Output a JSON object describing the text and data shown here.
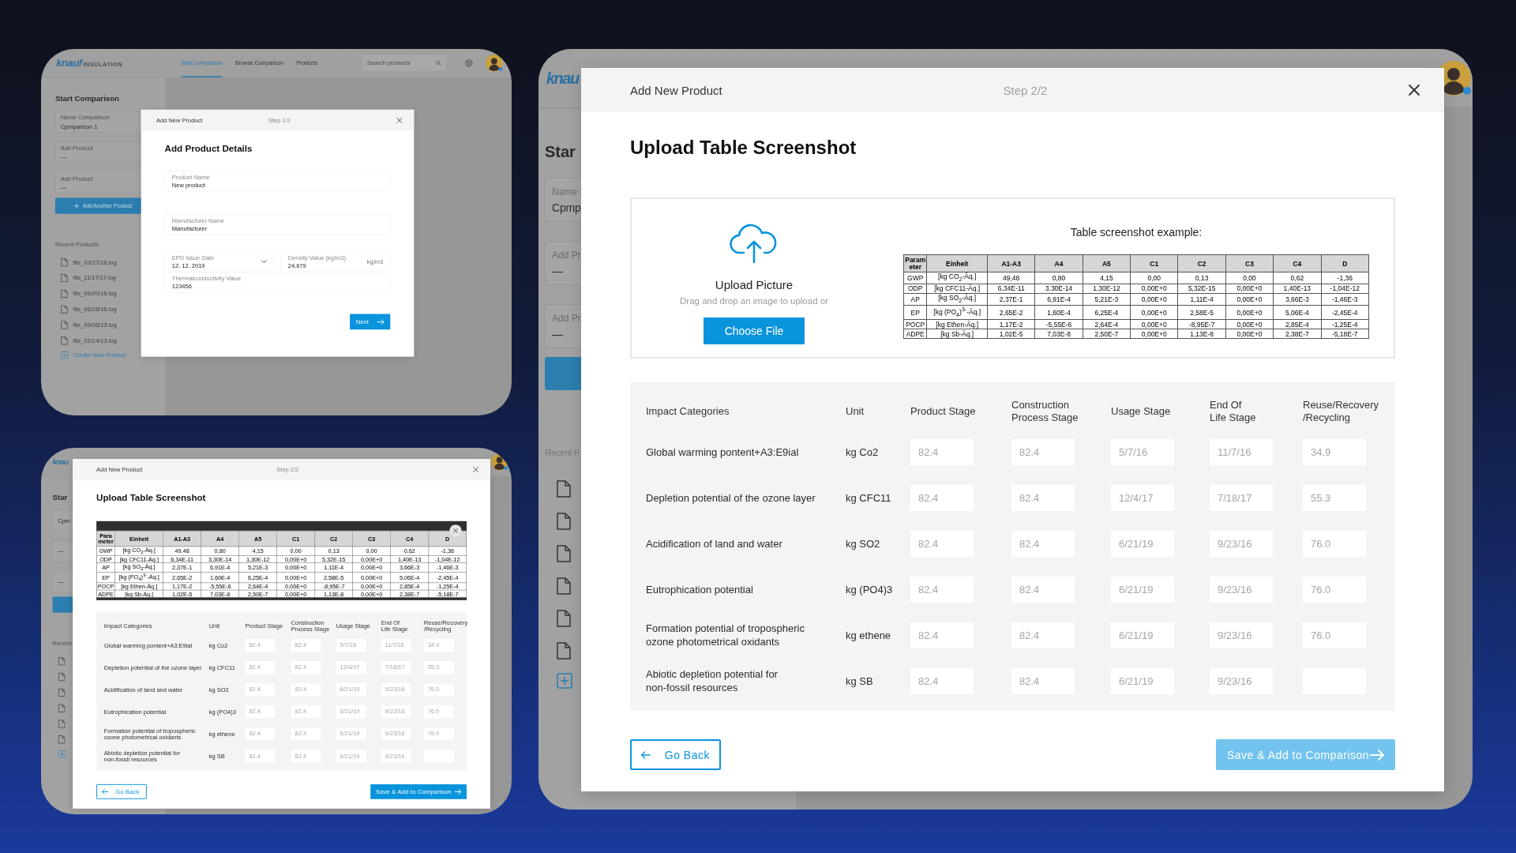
{
  "panels": [
    {
      "kind": "details",
      "app": {
        "logo": {
          "brand": "knauf",
          "sub": "INSULATION"
        },
        "nav": [
          {
            "label": "Start Comparison",
            "selected": true
          },
          {
            "label": "Browse Comparison",
            "selected": false
          },
          {
            "label": "Products",
            "selected": false
          }
        ],
        "search": {
          "placeholder": "Search products"
        },
        "sidebar": {
          "title": "Start Comparison",
          "fields": [
            {
              "label": "Name Comparison",
              "value": "Cpmparison 1"
            },
            {
              "label": "Add Product",
              "value": "—"
            },
            {
              "label": "Add Product",
              "value": "—"
            }
          ],
          "add_button": {
            "kind": "labeled",
            "label": "Add Another Product"
          },
          "recent_title": "Recent Products",
          "files": [
            {
              "kind": "named",
              "name": "file_03/27/18.log"
            },
            {
              "kind": "named",
              "name": "file_11/17/17.log"
            },
            {
              "kind": "named",
              "name": "file_06/20/16.log"
            },
            {
              "kind": "named",
              "name": "file_06/28/16.log"
            },
            {
              "kind": "named",
              "name": "file_09/06/13.log"
            },
            {
              "kind": "named",
              "name": "file_02/14/13.log"
            }
          ],
          "create": {
            "kind": "link",
            "label": "Create New Product"
          }
        }
      },
      "modal": {
        "title": "Add New Product",
        "step": "Step 1/2",
        "heading": "Add Product Details",
        "field_rows": [
          [
            {
              "kind": "text",
              "label": "Product Name",
              "value": "New product"
            }
          ],
          [
            {
              "kind": "text",
              "label": "Manufacturer Name",
              "value": "Manufacturer"
            }
          ],
          [
            {
              "kind": "select",
              "label": "EPD Issue Date",
              "value": "12. 12. 2019"
            },
            {
              "kind": "unit",
              "label": "Density Value (kg/m3)",
              "value": "24,679",
              "unit": "kg/m3"
            }
          ],
          [
            {
              "kind": "text",
              "label": "Thermalconductivity Value",
              "value": "123456"
            }
          ]
        ],
        "buttons": [
          {
            "kind": "next",
            "label": "Next"
          }
        ]
      }
    },
    {
      "kind": "preview",
      "app": {
        "logo": {
          "brand": "knau"
        },
        "sidebar": {
          "title": "Star",
          "fields": [
            {
              "value": "Cpm"
            },
            {
              "value": "—"
            },
            {
              "value": "—"
            }
          ],
          "add_button": {
            "kind": "blank"
          },
          "recent_title": "Recent",
          "files": [
            {
              "kind": "icon"
            },
            {
              "kind": "icon"
            },
            {
              "kind": "icon"
            },
            {
              "kind": "icon"
            },
            {
              "kind": "icon"
            },
            {
              "kind": "icon"
            }
          ],
          "create": {
            "kind": "icon"
          }
        }
      },
      "modal": {
        "title": "Add New Product",
        "step": "Step 2/2",
        "heading": "Upload Table Screenshot",
        "upload": {
          "kind": "preview",
          "example_table": {
            "columns": [
              "Parameter",
              "Einheit",
              "A1-A3",
              "A4",
              "A5",
              "C1",
              "C2",
              "C3",
              "C4",
              "D"
            ],
            "rows": [
              [
                "GWP",
                "[kg CO$_{2}$-Äq.]",
                "49,48",
                "0,80",
                "4,15",
                "0,00",
                "0,13",
                "0,00",
                "0,62",
                "-1,36"
              ],
              [
                "ODP",
                "[kg CFC11-Äq.]",
                "6,34E-11",
                "3,30E-14",
                "1,30E-12",
                "0,00E+0",
                "5,32E-15",
                "0,00E+0",
                "1,40E-13",
                "-1,04E-12"
              ],
              [
                "AP",
                "[kg SO$_{2}$-Äq.]",
                "2,37E-1",
                "6,91E-4",
                "5,21E-3",
                "0,00E+0",
                "1,11E-4",
                "0,00E+0",
                "3,66E-3",
                "-1,46E-3"
              ],
              [
                "EP",
                "[kg (PO$_{4}$)$^{3-}$-Äq.]",
                "2,65E-2",
                "1,60E-4",
                "6,25E-4",
                "0,00E+0",
                "2,58E-5",
                "0,00E+0",
                "5,06E-4",
                "-2,45E-4"
              ],
              [
                "POCP",
                "[kg Ethen-Äq.]",
                "1,17E-2",
                "-5,55E-6",
                "2,64E-4",
                "0,00E+0",
                "-8,95E-7",
                "0,00E+0",
                "2,85E-4",
                "-1,25E-4"
              ],
              [
                "ADPE",
                "[kg Sb-Äq.]",
                "1,02E-5",
                "7,03E-8",
                "2,50E-7",
                "0,00E+0",
                "1,13E-8",
                "0,00E+0",
                "2,38E-7",
                "-5,18E-7"
              ]
            ]
          }
        },
        "impact_table": {
          "columns": [
            "Impact Categories",
            "Unit",
            "Product Stage",
            "Construction\nProcess Stage",
            "Usage Stage",
            "End Of\nLife Stage",
            "Reuse/Recovery\n/Recycling"
          ],
          "rows": [
            {
              "category": "Global warming pontent+A3:E9ial",
              "unit": "kg Co2",
              "values": [
                "82.4",
                "82.4",
                "5/7/16",
                "11/7/16",
                "34.9"
              ]
            },
            {
              "category": "Depletion potential of the ozone layer",
              "unit": "kg CFC11",
              "values": [
                "82.4",
                "82.4",
                "12/4/17",
                "7/18/17",
                "55.3"
              ]
            },
            {
              "category": "Acidification of land and water",
              "unit": "kg SO2",
              "values": [
                "82.4",
                "82.4",
                "6/21/19",
                "9/23/16",
                "76.0"
              ]
            },
            {
              "category": "Eutrophication potential",
              "unit": "kg (PO4)3",
              "values": [
                "82.4",
                "82.4",
                "6/21/19",
                "9/23/16",
                "76.0"
              ]
            },
            {
              "category": "Formation potential of tropospheric\nozone photometrical oxidants",
              "unit": "kg ethene",
              "values": [
                "82.4",
                "82.4",
                "6/21/19",
                "9/23/16",
                "76.0"
              ]
            },
            {
              "category": "Abiotic depletion potential for\nnon-fossil resources",
              "unit": "kg SB",
              "values": [
                "82.4",
                "82.4",
                "6/21/19",
                "9/23/16"
              ]
            }
          ]
        },
        "buttons": [
          {
            "kind": "back",
            "label": "Go Back"
          },
          {
            "kind": "save",
            "label": "Save & Add to Comparison",
            "disabled": false
          }
        ]
      }
    },
    {
      "kind": "dropzone",
      "app": {
        "logo": {
          "brand": "knau"
        },
        "sidebar": {
          "title": "Star",
          "fields": [
            {
              "label": "Name",
              "value": "Cpmp"
            },
            {
              "label": "Add Pr",
              "value": "—"
            },
            {
              "label": "Add Pr",
              "value": "—"
            }
          ],
          "add_button": {
            "kind": "blank"
          },
          "recent_title": "Recent P",
          "files": [
            {
              "kind": "icon"
            },
            {
              "kind": "icon"
            },
            {
              "kind": "icon"
            },
            {
              "kind": "icon"
            },
            {
              "kind": "icon"
            },
            {
              "kind": "icon"
            }
          ],
          "create": {
            "kind": "icon"
          }
        }
      },
      "modal": {
        "title": "Add New Product",
        "step": "Step 2/2",
        "heading": "Upload Table Screenshot",
        "upload": {
          "kind": "dropzone",
          "title": "Upload Picture",
          "hint": "Drag and drop an image to upload or",
          "button": "Choose File",
          "example_title": "Table screenshot example:",
          "example_table": {
            "columns": [
              "Parameter",
              "Einheit",
              "A1-A3",
              "A4",
              "A5",
              "C1",
              "C2",
              "C3",
              "C4",
              "D"
            ],
            "rows": [
              [
                "GWP",
                "[kg CO$_{2}$-Äq.]",
                "49,48",
                "0,80",
                "4,15",
                "0,00",
                "0,13",
                "0,00",
                "0,62",
                "-1,36"
              ],
              [
                "ODP",
                "[kg CFC11-Äq.]",
                "6,34E-11",
                "3,30E-14",
                "1,30E-12",
                "0,00E+0",
                "5,32E-15",
                "0,00E+0",
                "1,40E-13",
                "-1,04E-12"
              ],
              [
                "AP",
                "[kg SO$_{2}$-Äq.]",
                "2,37E-1",
                "6,91E-4",
                "5,21E-3",
                "0,00E+0",
                "1,11E-4",
                "0,00E+0",
                "3,66E-3",
                "-1,46E-3"
              ],
              [
                "EP",
                "[kg (PO$_{4}$)$^{3-}$-Äq.]",
                "2,65E-2",
                "1,60E-4",
                "6,25E-4",
                "0,00E+0",
                "2,58E-5",
                "0,00E+0",
                "5,06E-4",
                "-2,45E-4"
              ],
              [
                "POCP",
                "[kg Ethen-Äq.]",
                "1,17E-2",
                "-5,55E-6",
                "2,64E-4",
                "0,00E+0",
                "-8,95E-7",
                "0,00E+0",
                "2,85E-4",
                "-1,25E-4"
              ],
              [
                "ADPE",
                "[kg Sb-Äq.]",
                "1,02E-5",
                "7,03E-8",
                "2,50E-7",
                "0,00E+0",
                "1,13E-8",
                "0,00E+0",
                "2,38E-7",
                "-5,18E-7"
              ]
            ]
          }
        },
        "impact_table": {
          "columns": [
            "Impact Categories",
            "Unit",
            "Product Stage",
            "Construction\nProcess Stage",
            "Usage Stage",
            "End Of\nLife Stage",
            "Reuse/Recovery\n/Recycling"
          ],
          "rows": [
            {
              "category": "Global warming pontent+A3:E9ial",
              "unit": "kg Co2",
              "values": [
                "82.4",
                "82.4",
                "5/7/16",
                "11/7/16",
                "34.9"
              ]
            },
            {
              "category": "Depletion potential of the ozone layer",
              "unit": "kg CFC11",
              "values": [
                "82.4",
                "82.4",
                "12/4/17",
                "7/18/17",
                "55.3"
              ]
            },
            {
              "category": "Acidification of land and water",
              "unit": "kg SO2",
              "values": [
                "82.4",
                "82.4",
                "6/21/19",
                "9/23/16",
                "76.0"
              ]
            },
            {
              "category": "Eutrophication potential",
              "unit": "kg (PO4)3",
              "values": [
                "82.4",
                "82.4",
                "6/21/19",
                "9/23/16",
                "76.0"
              ]
            },
            {
              "category": "Formation potential of tropospheric\nozone photometrical oxidants",
              "unit": "kg ethene",
              "values": [
                "82.4",
                "82.4",
                "6/21/19",
                "9/23/16",
                "76.0"
              ]
            },
            {
              "category": "Abiotic depletion potential for\nnon-fossil resources",
              "unit": "kg SB",
              "values": [
                "82.4",
                "82.4",
                "6/21/19",
                "9/23/16"
              ]
            }
          ]
        },
        "buttons": [
          {
            "kind": "back",
            "label": "Go Back"
          },
          {
            "kind": "save",
            "label": "Save & Add to Comparison",
            "disabled": true
          }
        ]
      }
    }
  ]
}
